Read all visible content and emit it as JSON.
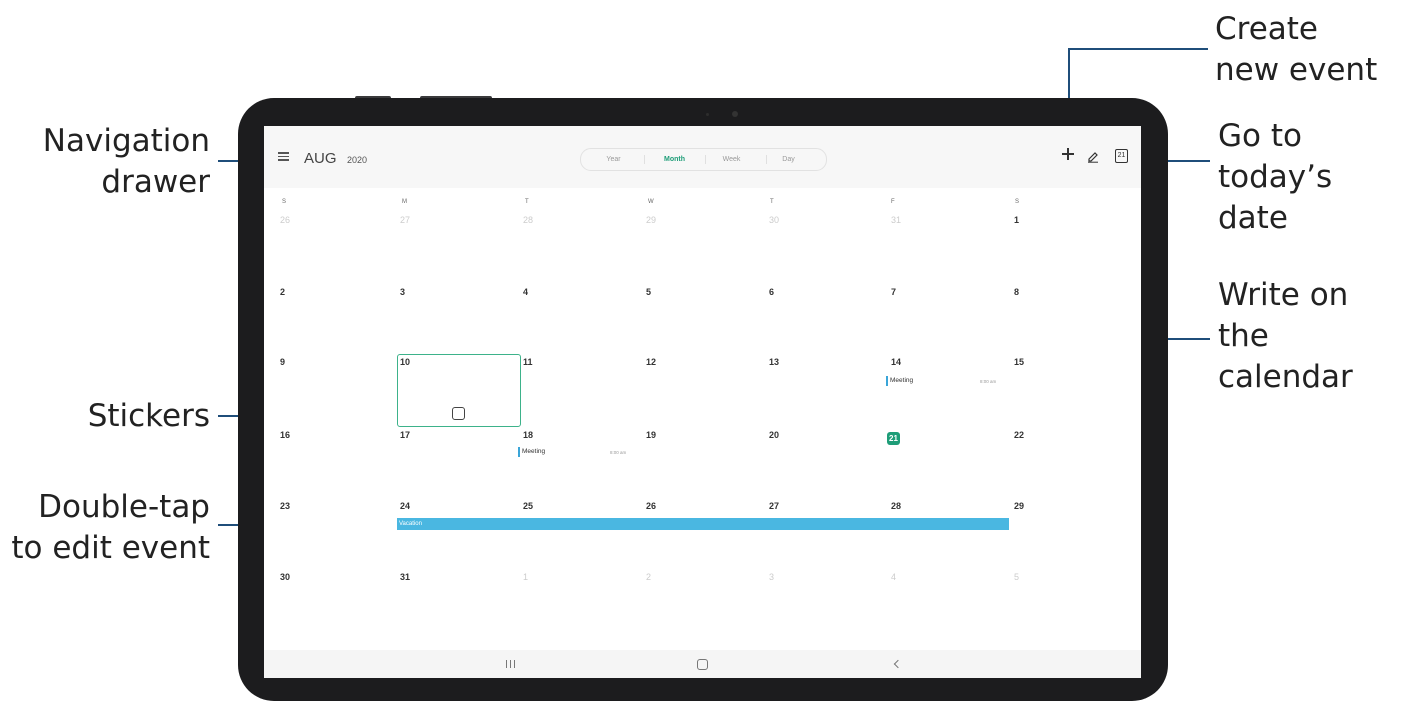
{
  "callouts": {
    "navigation_drawer": [
      "Navigation",
      "drawer"
    ],
    "stickers": "Stickers",
    "double_tap": [
      "Double-tap",
      "to edit event"
    ],
    "create_new_event": [
      "Create",
      "new event"
    ],
    "go_to_today": [
      "Go to",
      "today’s",
      "date"
    ],
    "write_on_calendar": [
      "Write on",
      "the",
      "calendar"
    ]
  },
  "header": {
    "month": "AUG",
    "year": "2020",
    "views": [
      "Year",
      "Month",
      "Week",
      "Day"
    ],
    "active_view": "Month",
    "today_icon_label": "21"
  },
  "weekdays": [
    "S",
    "M",
    "T",
    "W",
    "T",
    "F",
    "S"
  ],
  "weeks": [
    [
      {
        "d": "26",
        "faded": true
      },
      {
        "d": "27",
        "faded": true
      },
      {
        "d": "28",
        "faded": true
      },
      {
        "d": "29",
        "faded": true
      },
      {
        "d": "30",
        "faded": true
      },
      {
        "d": "31",
        "faded": true
      },
      {
        "d": "1"
      }
    ],
    [
      {
        "d": "2"
      },
      {
        "d": "3"
      },
      {
        "d": "4"
      },
      {
        "d": "5"
      },
      {
        "d": "6"
      },
      {
        "d": "7"
      },
      {
        "d": "8"
      }
    ],
    [
      {
        "d": "9"
      },
      {
        "d": "10"
      },
      {
        "d": "11"
      },
      {
        "d": "12"
      },
      {
        "d": "13"
      },
      {
        "d": "14"
      },
      {
        "d": "15"
      }
    ],
    [
      {
        "d": "16"
      },
      {
        "d": "17"
      },
      {
        "d": "18"
      },
      {
        "d": "19"
      },
      {
        "d": "20"
      },
      {
        "d": "21",
        "today": true
      },
      {
        "d": "22"
      }
    ],
    [
      {
        "d": "23"
      },
      {
        "d": "24"
      },
      {
        "d": "25"
      },
      {
        "d": "26"
      },
      {
        "d": "27"
      },
      {
        "d": "28"
      },
      {
        "d": "29"
      }
    ],
    [
      {
        "d": "30"
      },
      {
        "d": "31"
      },
      {
        "d": "1",
        "faded": true
      },
      {
        "d": "2",
        "faded": true
      },
      {
        "d": "3",
        "faded": true
      },
      {
        "d": "4",
        "faded": true
      },
      {
        "d": "5",
        "faded": true
      }
    ]
  ],
  "events": [
    {
      "title": "Meeting",
      "time": "8:00 am",
      "date": "14"
    },
    {
      "title": "Meeting",
      "time": "8:00 am",
      "date": "18"
    }
  ],
  "vacation": {
    "title": "Vacation",
    "start": "24",
    "end": "28"
  },
  "selected_date": "10",
  "colors": {
    "accent": "#1e9d78",
    "event_bar": "#4ab7e1",
    "callout_line": "#1f4e7a"
  }
}
